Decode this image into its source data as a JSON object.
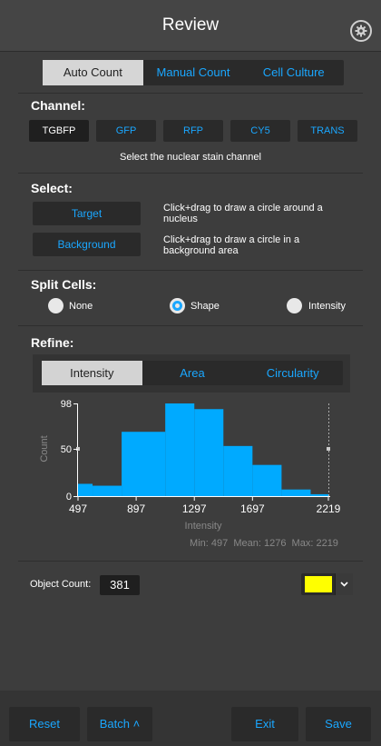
{
  "header": {
    "title": "Review",
    "settings_icon": "gear-icon"
  },
  "mode_tabs": [
    {
      "label": "Auto Count",
      "active": true
    },
    {
      "label": "Manual Count",
      "active": false
    },
    {
      "label": "Cell Culture",
      "active": false
    }
  ],
  "channel": {
    "heading": "Channel:",
    "buttons": [
      {
        "label": "TGBFP",
        "active": true
      },
      {
        "label": "GFP",
        "active": false
      },
      {
        "label": "RFP",
        "active": false
      },
      {
        "label": "CY5",
        "active": false
      },
      {
        "label": "TRANS",
        "active": false
      }
    ],
    "hint": "Select the nuclear stain channel"
  },
  "select": {
    "heading": "Select:",
    "target_label": "Target",
    "target_desc": "Click+drag to draw a circle around a nucleus",
    "background_label": "Background",
    "background_desc": "Click+drag to draw a circle in a background area"
  },
  "split": {
    "heading": "Split Cells:",
    "options": [
      {
        "label": "None",
        "selected": false
      },
      {
        "label": "Shape",
        "selected": true
      },
      {
        "label": "Intensity",
        "selected": false
      }
    ]
  },
  "refine": {
    "heading": "Refine:",
    "tabs": [
      {
        "label": "Intensity",
        "active": true
      },
      {
        "label": "Area",
        "active": false
      },
      {
        "label": "Circularity",
        "active": false
      }
    ]
  },
  "chart_data": {
    "type": "bar",
    "bar_color": "#00aaff",
    "ylabel": "Count",
    "xlabel": "Intensity",
    "ylim": [
      0,
      98
    ],
    "xlim": [
      497,
      2219
    ],
    "y_ticks": [
      "0",
      "50",
      "98"
    ],
    "x_ticks": [
      "497",
      "897",
      "1297",
      "1697",
      "2219"
    ],
    "bins": [
      {
        "x0": 497,
        "x1": 597,
        "count": 13
      },
      {
        "x0": 597,
        "x1": 797,
        "count": 11
      },
      {
        "x0": 797,
        "x1": 1097,
        "count": 68
      },
      {
        "x0": 1097,
        "x1": 1297,
        "count": 98
      },
      {
        "x0": 1297,
        "x1": 1497,
        "count": 92
      },
      {
        "x0": 1497,
        "x1": 1697,
        "count": 53
      },
      {
        "x0": 1697,
        "x1": 1897,
        "count": 33
      },
      {
        "x0": 1897,
        "x1": 2097,
        "count": 7
      },
      {
        "x0": 2097,
        "x1": 2219,
        "count": 2
      }
    ],
    "stats": "Min: 497  Mean: 1276  Max: 2219"
  },
  "object_count": {
    "label": "Object Count:",
    "value": "381",
    "color": "#ffff00"
  },
  "footer": {
    "reset": "Reset",
    "batch": "Batch ˄",
    "exit": "Exit",
    "save": "Save"
  }
}
